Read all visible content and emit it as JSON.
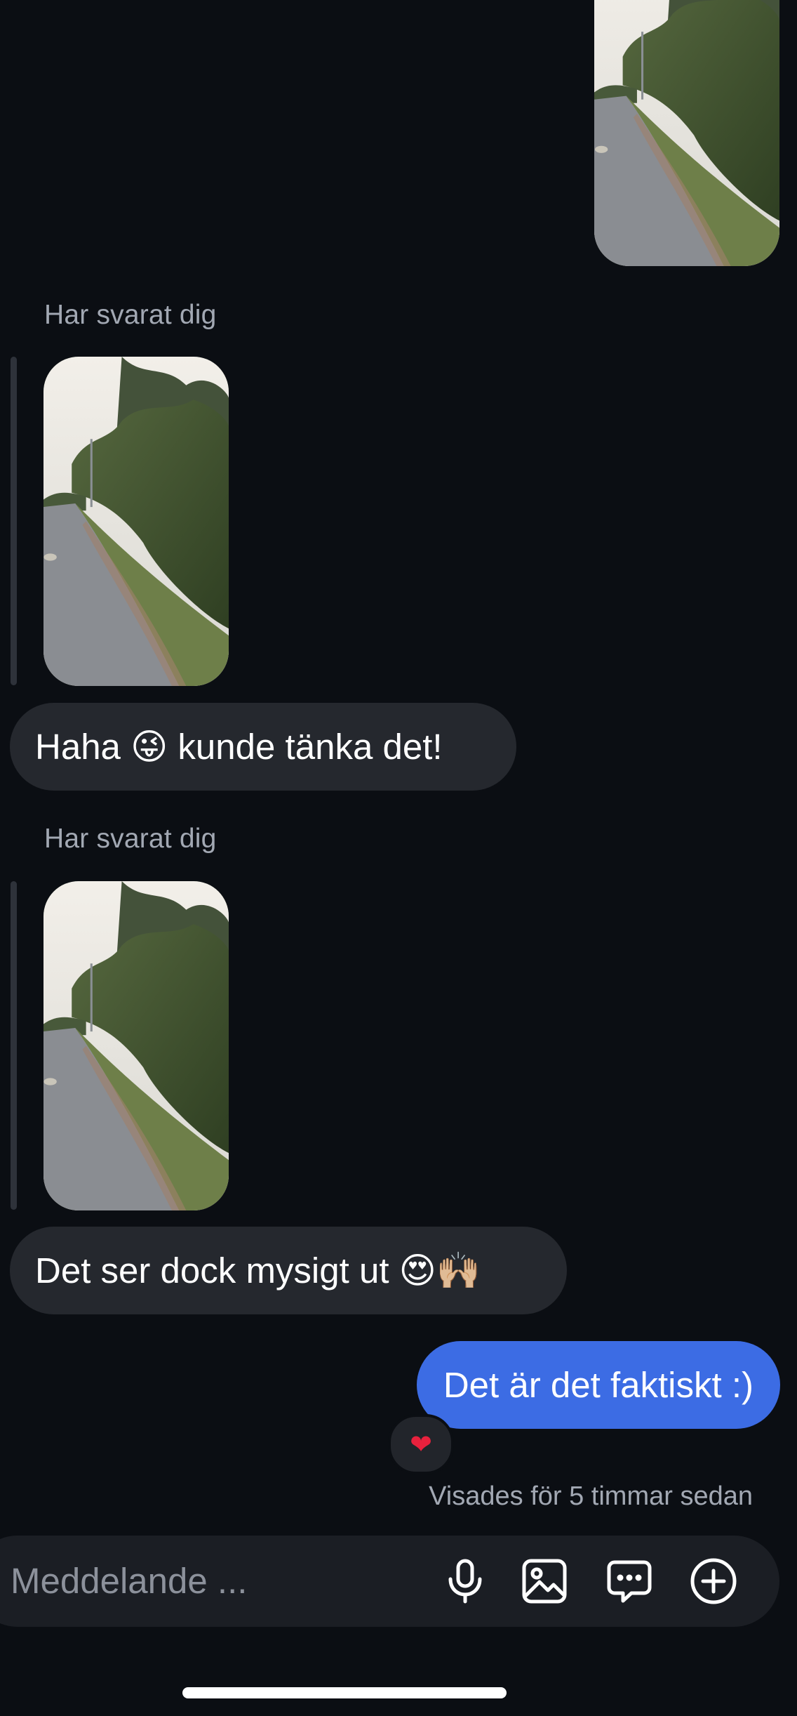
{
  "conversation": {
    "messages": [
      {
        "reply_label": "Har svarat dig",
        "text": "Haha 😜 kunde tänka det!"
      },
      {
        "reply_label": "Har svarat dig",
        "text": "Det ser dock mysigt ut 😍🙌🏼"
      }
    ],
    "outgoing": {
      "text": "Det är det faktiskt :)",
      "reaction": "❤",
      "seen_status": "Visades för 5 timmar sedan"
    }
  },
  "composer": {
    "placeholder": "Meddelande ...",
    "icons": [
      "microphone-icon",
      "image-icon",
      "chat-bubble-icon",
      "plus-circle-icon"
    ]
  },
  "colors": {
    "background": "#0b0e13",
    "incoming_bubble": "#25282e",
    "outgoing_bubble": "#3c6ce4",
    "secondary_text": "#a2a8b3"
  }
}
